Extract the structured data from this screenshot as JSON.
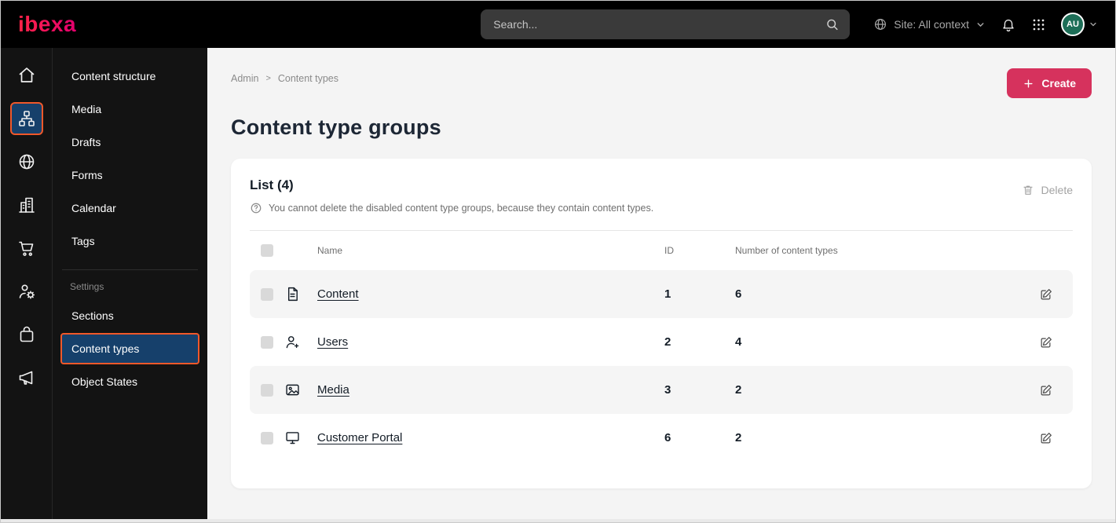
{
  "topbar": {
    "logo": "ibexa",
    "search_placeholder": "Search...",
    "site_context": "Site: All context",
    "avatar_initials": "AU"
  },
  "rail": {
    "items": [
      {
        "icon": "home-icon",
        "active": false
      },
      {
        "icon": "content-structure-icon",
        "active": true
      },
      {
        "icon": "site-globe-icon",
        "active": false
      },
      {
        "icon": "company-buildings-icon",
        "active": false
      },
      {
        "icon": "commerce-cart-icon",
        "active": false
      },
      {
        "icon": "personalization-user-gear-icon",
        "active": false
      },
      {
        "icon": "product-catalog-bag-icon",
        "active": false
      },
      {
        "icon": "marketing-megaphone-icon",
        "active": false
      }
    ]
  },
  "sidebar": {
    "items": [
      {
        "label": "Content structure"
      },
      {
        "label": "Media"
      },
      {
        "label": "Drafts"
      },
      {
        "label": "Forms"
      },
      {
        "label": "Calendar"
      },
      {
        "label": "Tags"
      }
    ],
    "settings_label": "Settings",
    "settings_items": [
      {
        "label": "Sections",
        "active": false
      },
      {
        "label": "Content types",
        "active": true
      },
      {
        "label": "Object States",
        "active": false
      }
    ]
  },
  "main": {
    "breadcrumb": {
      "items": [
        "Admin",
        "Content types"
      ],
      "separator": ">"
    },
    "create_button": "Create",
    "page_title": "Content type groups",
    "card": {
      "list_title": "List (4)",
      "info_text": "You cannot delete the disabled content type groups, because they contain content types.",
      "delete_button": "Delete",
      "table": {
        "headers": {
          "name": "Name",
          "id": "ID",
          "count": "Number of content types"
        },
        "rows": [
          {
            "icon": "content-file-icon",
            "name": "Content",
            "id": "1",
            "count": "6"
          },
          {
            "icon": "users-person-icon",
            "name": "Users",
            "id": "2",
            "count": "4"
          },
          {
            "icon": "media-image-icon",
            "name": "Media",
            "id": "3",
            "count": "2"
          },
          {
            "icon": "customer-portal-monitor-icon",
            "name": "Customer Portal",
            "id": "6",
            "count": "2"
          }
        ]
      }
    }
  },
  "colors": {
    "accent_red": "#d6325d",
    "highlight_orange": "#f0582a",
    "active_blue": "#16406b",
    "topbar_black": "#000000",
    "sidebar_dark": "#131313",
    "stripe_gray": "#f5f5f5",
    "avatar_green": "#1d6e57"
  }
}
